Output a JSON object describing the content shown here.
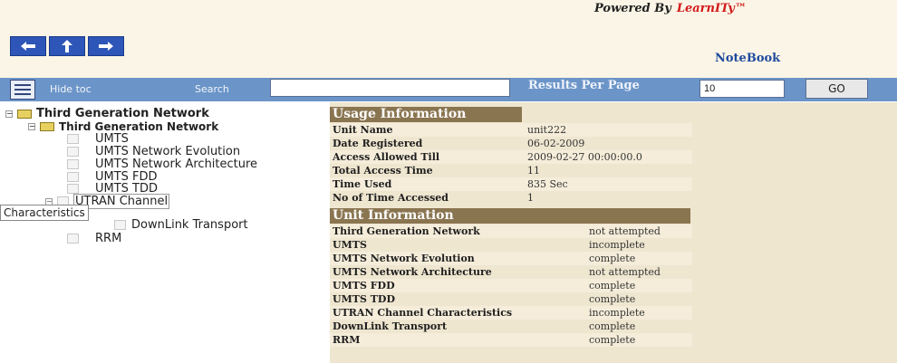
{
  "header": {
    "powered_by": "Powered By",
    "brand": "LearnITy™",
    "notebook": "NoteBook",
    "nav": [
      {
        "icon": "back-arrow-icon"
      },
      {
        "icon": "up-arrow-icon"
      },
      {
        "icon": "forward-arrow-icon"
      }
    ]
  },
  "toolbar": {
    "hide_toc": "Hide toc",
    "search_label": "Search",
    "search_value": "",
    "results_per_page_label": "Results Per Page",
    "results_per_page_value": "10",
    "go_label": "GO"
  },
  "toc": {
    "root": "Third Generation Network",
    "child": "Third Generation Network",
    "items": [
      "UMTS",
      "UMTS Network Evolution",
      "UMTS Network Architecture",
      "UMTS FDD",
      "UMTS TDD",
      "UTRAN Channel",
      "DownLink Transport",
      "RRM"
    ],
    "tooltip": "Characteristics"
  },
  "usage": {
    "title": "Usage Information",
    "rows": [
      {
        "label": "Unit Name",
        "value": "unit222"
      },
      {
        "label": "Date Registered",
        "value": "06-02-2009"
      },
      {
        "label": "Access Allowed Till",
        "value": "2009-02-27 00:00:00.0"
      },
      {
        "label": "Total Access Time",
        "value": "11"
      },
      {
        "label": "Time Used",
        "value": "835 Sec"
      },
      {
        "label": "No of Time Accessed",
        "value": "1"
      }
    ]
  },
  "unit_info": {
    "title": "Unit Information",
    "rows": [
      {
        "label": "Third Generation Network",
        "value": "not attempted"
      },
      {
        "label": "UMTS",
        "value": "incomplete"
      },
      {
        "label": "UMTS Network Evolution",
        "value": "complete"
      },
      {
        "label": "UMTS Network Architecture",
        "value": "not attempted"
      },
      {
        "label": "UMTS FDD",
        "value": "complete"
      },
      {
        "label": "UMTS TDD",
        "value": "complete"
      },
      {
        "label": "UTRAN Channel Characteristics",
        "value": "incomplete"
      },
      {
        "label": "DownLink Transport",
        "value": "complete"
      },
      {
        "label": "RRM",
        "value": "complete"
      }
    ]
  }
}
